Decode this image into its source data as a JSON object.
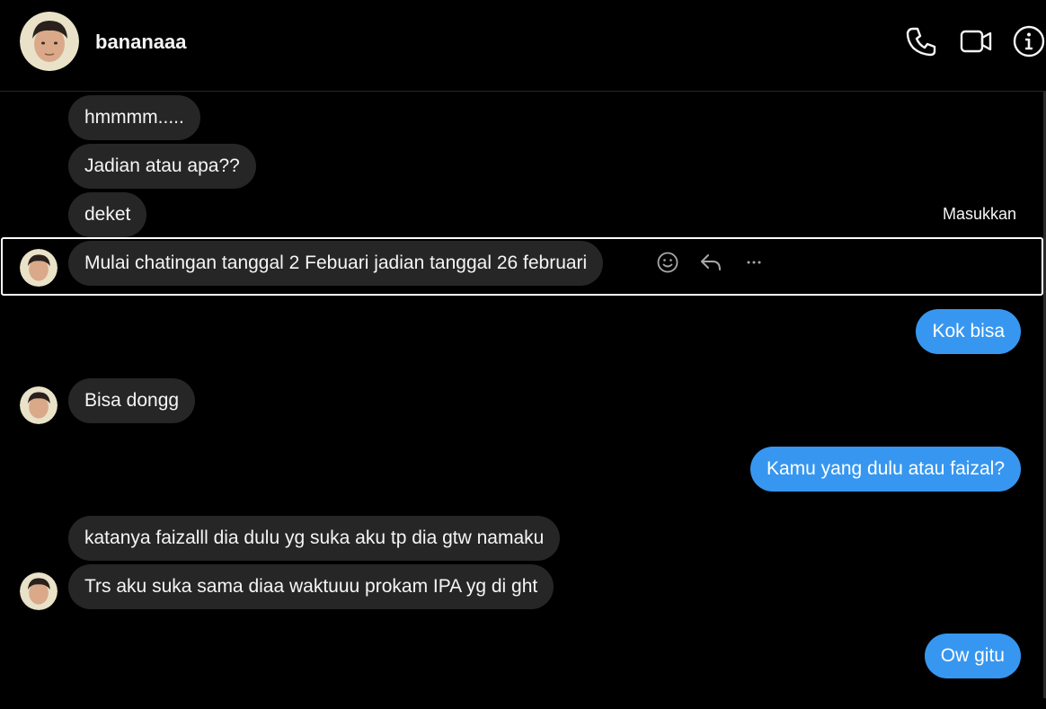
{
  "header": {
    "username": "bananaaa",
    "icons": [
      "phone-icon",
      "video-call-icon",
      "info-icon"
    ]
  },
  "hover_action": {
    "label": "Masukkan",
    "icons": [
      "emoji-react-icon",
      "reply-icon",
      "more-options-icon"
    ]
  },
  "messages": [
    {
      "side": "incoming",
      "text": "hmmmm....."
    },
    {
      "side": "incoming",
      "text": "Jadian atau apa??"
    },
    {
      "side": "incoming",
      "text": "deket"
    },
    {
      "side": "incoming",
      "text": "Mulai chatingan tanggal 2 Febuari jadian tanggal 26 februari"
    },
    {
      "side": "outgoing",
      "text": "Kok bisa"
    },
    {
      "side": "incoming",
      "text": "Bisa dongg"
    },
    {
      "side": "outgoing",
      "text": "Kamu yang dulu atau faizal?"
    },
    {
      "side": "incoming",
      "text": "katanya faizalll dia dulu yg suka aku tp dia gtw namaku"
    },
    {
      "side": "incoming",
      "text": "Trs aku suka sama diaa waktuuu prokam IPA yg di ght"
    },
    {
      "side": "outgoing",
      "text": "Ow gitu"
    }
  ],
  "colors": {
    "background": "#000000",
    "incoming_bubble": "#262626",
    "outgoing_bubble": "#3797f0",
    "text": "#f5f5f5"
  }
}
